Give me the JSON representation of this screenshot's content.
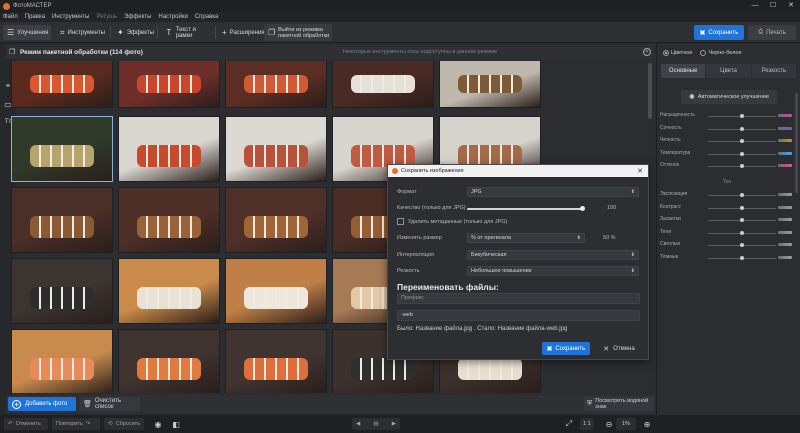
{
  "window": {
    "title": "ФотоМАСТЕР",
    "min": "—",
    "max": "☐",
    "close": "✕"
  },
  "menu": [
    {
      "label": "Файл",
      "enabled": true
    },
    {
      "label": "Правка",
      "enabled": true
    },
    {
      "label": "Инструменты",
      "enabled": true
    },
    {
      "label": "Ретушь",
      "enabled": false
    },
    {
      "label": "Эффекты",
      "enabled": true
    },
    {
      "label": "Настройки",
      "enabled": true
    },
    {
      "label": "Справка",
      "enabled": true
    }
  ],
  "toolbar": {
    "improve": "Улучшения",
    "tools": "Инструменты",
    "effects": "Эффекты",
    "text_frames": "Текст и рамки",
    "extensions": "Расширения",
    "exit_batch_line1": "Выйти из режима",
    "exit_batch_line2": "пакетной обработки",
    "save": "Сохранить",
    "print": "Печать"
  },
  "gallery": {
    "title": "Режим пакетной обработки (114 фото)",
    "note": "Некоторые инструменты пока недоступны в данном режиме",
    "add_photo": "Добавить фото",
    "clear_list": "Очистить список",
    "view_watermark": "Посмотреть водяной знак",
    "thumbs": [
      {
        "bg": "#5a2a1f",
        "food": "#d8572f"
      },
      {
        "bg": "#6e2f2a",
        "food": "#c9452b"
      },
      {
        "bg": "#5c2d22",
        "food": "#cf5a34"
      },
      {
        "bg": "#4a2a24",
        "food": "#e5e0d8"
      },
      {
        "bg": "#bfb8ad",
        "food": "#7c5a36"
      },
      {
        "bg": "#2f3a2a",
        "food": "#b7a46b"
      },
      {
        "bg": "#d9d6d0",
        "food": "#c74a2d"
      },
      {
        "bg": "#dcd8d2",
        "food": "#b8523a"
      },
      {
        "bg": "#d8d4ce",
        "food": "#c05a42"
      },
      {
        "bg": "#d6d2cc",
        "food": "#a56a48"
      },
      {
        "bg": "#4a2e28",
        "food": "#8a5a32"
      },
      {
        "bg": "#4d2f27",
        "food": "#9a6236"
      },
      {
        "bg": "#4f3028",
        "food": "#a06536"
      },
      {
        "bg": "#4b2d26",
        "food": "#955e34"
      },
      {
        "bg": "#c9c4bc",
        "food": "#9c6a40"
      },
      {
        "bg": "#3b3431",
        "food": "#2d2d2d"
      },
      {
        "bg": "#c98a4a",
        "food": "#e9e1d4"
      },
      {
        "bg": "#c07f46",
        "food": "#efe7dc"
      },
      {
        "bg": "#a57a55",
        "food": "#e2c8a4"
      },
      {
        "bg": "#cfcac3",
        "food": "#d77a4f"
      },
      {
        "bg": "#c88a4d",
        "food": "#e88a5a"
      },
      {
        "bg": "#3e332f",
        "food": "#e07a3e"
      },
      {
        "bg": "#3f3430",
        "food": "#df6f3a"
      },
      {
        "bg": "#3b312d",
        "food": "#2f2f2f"
      },
      {
        "bg": "#3a302c",
        "food": "#e8dfcf"
      }
    ]
  },
  "left_tools": {
    "brush": "⌖",
    "frame": "▭",
    "text": "Tт"
  },
  "right_panel": {
    "color_label": "Цветное",
    "bw_label": "Черно-белое",
    "tabs": [
      "Основные",
      "Цвета",
      "Резкость"
    ],
    "auto_improve": "Автоматическое улучшение",
    "tone_label": "Тон",
    "sliders_top": [
      {
        "label": "Насыщенность",
        "knob": 0.5,
        "swatch": "#d14aa8"
      },
      {
        "label": "Сочность",
        "knob": 0.5,
        "swatch": "#7a56d6"
      },
      {
        "label": "Четкость",
        "knob": 0.5,
        "swatch": "#c98b2a"
      },
      {
        "label": "Температура",
        "knob": 0.5,
        "swatch": "#3ea6ff"
      },
      {
        "label": "Оттенок",
        "knob": 0.5,
        "swatch": "#e052a8"
      }
    ],
    "sliders_tone": [
      {
        "label": "Экспозиция",
        "knob": 0.5,
        "swatch": "#9a9da2"
      },
      {
        "label": "Контраст",
        "knob": 0.5,
        "swatch": "#9a9da2"
      },
      {
        "label": "Засветки",
        "knob": 0.5,
        "swatch": "#9a9da2"
      },
      {
        "label": "Тени",
        "knob": 0.5,
        "swatch": "#9a9da2"
      },
      {
        "label": "Светлые",
        "knob": 0.5,
        "swatch": "#9a9da2"
      },
      {
        "label": "Тёмные",
        "knob": 0.5,
        "swatch": "#9a9da2"
      }
    ]
  },
  "status_bar": {
    "undo": "Отменить",
    "redo": "Повторить",
    "reset": "Сбросить",
    "ratio": "1:1",
    "zoom": "1%"
  },
  "dialog": {
    "title": "Сохранить изображения",
    "format_label": "Формат",
    "format_value": "JPG",
    "quality_label": "Качество (только для JPG)",
    "quality_value": "100",
    "meta_label": "Удалить метаданные (только для JPG)",
    "resize_label": "Изменить размер",
    "resize_value": "% от оригинала",
    "resize_percent": "50 %",
    "interp_label": "Интерполяция",
    "interp_value": "Бикубическая",
    "sharp_label": "Резкость",
    "sharp_value": "Небольшое повышение",
    "rename_title": "Переименовать файлы:",
    "prefix_placeholder": "Префикс",
    "suffix_value": "-web",
    "preview_text": "Было: Название файла.jpg . Стало: Название файла-web.jpg",
    "save": "Сохранить",
    "cancel": "Отмена"
  },
  "colors": {
    "accent": "#1e74d8",
    "bg": "#2b2d31",
    "panel": "#2e3034"
  }
}
